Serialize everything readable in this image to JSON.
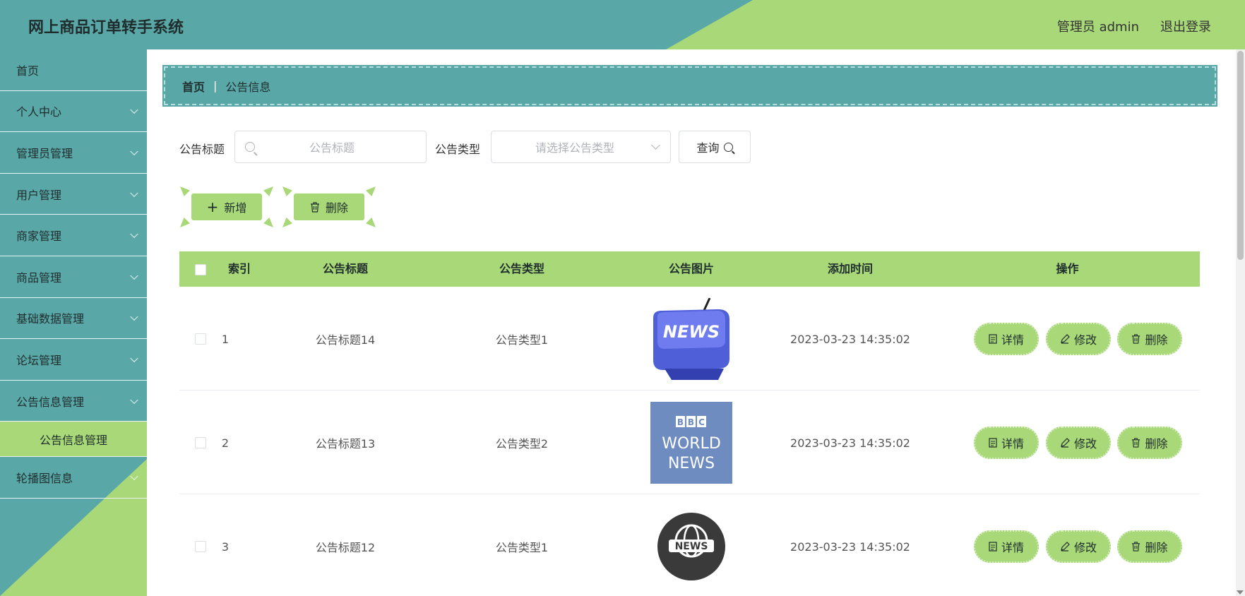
{
  "header": {
    "title": "网上商品订单转手系统",
    "admin": "管理员 admin",
    "logout": "退出登录"
  },
  "sidebar": {
    "items": [
      {
        "label": "首页"
      },
      {
        "label": "个人中心"
      },
      {
        "label": "管理员管理"
      },
      {
        "label": "用户管理"
      },
      {
        "label": "商家管理"
      },
      {
        "label": "商品管理"
      },
      {
        "label": "基础数据管理"
      },
      {
        "label": "论坛管理"
      },
      {
        "label": "公告信息管理"
      }
    ],
    "active_sub": "公告信息管理",
    "last_item": "轮播图信息"
  },
  "breadcrumb": {
    "home": "首页",
    "sep": "|",
    "current": "公告信息"
  },
  "filters": {
    "title_label": "公告标题",
    "title_placeholder": "公告标题",
    "type_label": "公告类型",
    "type_placeholder": "请选择公告类型",
    "query_label": "查询"
  },
  "actions": {
    "add": "新增",
    "delete": "删除"
  },
  "table": {
    "columns": [
      "索引",
      "公告标题",
      "公告类型",
      "公告图片",
      "添加时间",
      "操作"
    ],
    "rows": [
      {
        "index": "1",
        "title": "公告标题14",
        "type": "公告类型1",
        "time": "2023-03-23 14:35:02",
        "image": "NEWS"
      },
      {
        "index": "2",
        "title": "公告标题13",
        "type": "公告类型2",
        "time": "2023-03-23 14:35:02",
        "image": "BBC WORLD NEWS"
      },
      {
        "index": "3",
        "title": "公告标题12",
        "type": "公告类型1",
        "time": "2023-03-23 14:35:02",
        "image": "NEWS"
      }
    ],
    "ops": {
      "detail": "详情",
      "edit": "修改",
      "delete": "删除"
    }
  },
  "colors": {
    "teal": "#5aa7a7",
    "green": "#a8d878"
  }
}
